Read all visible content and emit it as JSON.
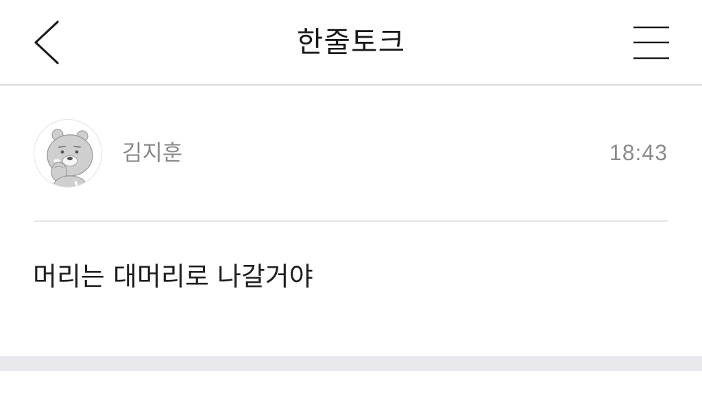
{
  "header": {
    "title": "한줄토크",
    "back_icon": "chevron-left-icon",
    "menu_icon": "hamburger-menu-icon"
  },
  "post": {
    "author": "김지훈",
    "time": "18:43",
    "avatar_icon": "bear-character-avatar",
    "message": "머리는 대머리로 나갈거야"
  },
  "colors": {
    "muted_text": "#8a8a8a",
    "divider": "#dadada",
    "bottom_band": "#e9e9ed"
  }
}
